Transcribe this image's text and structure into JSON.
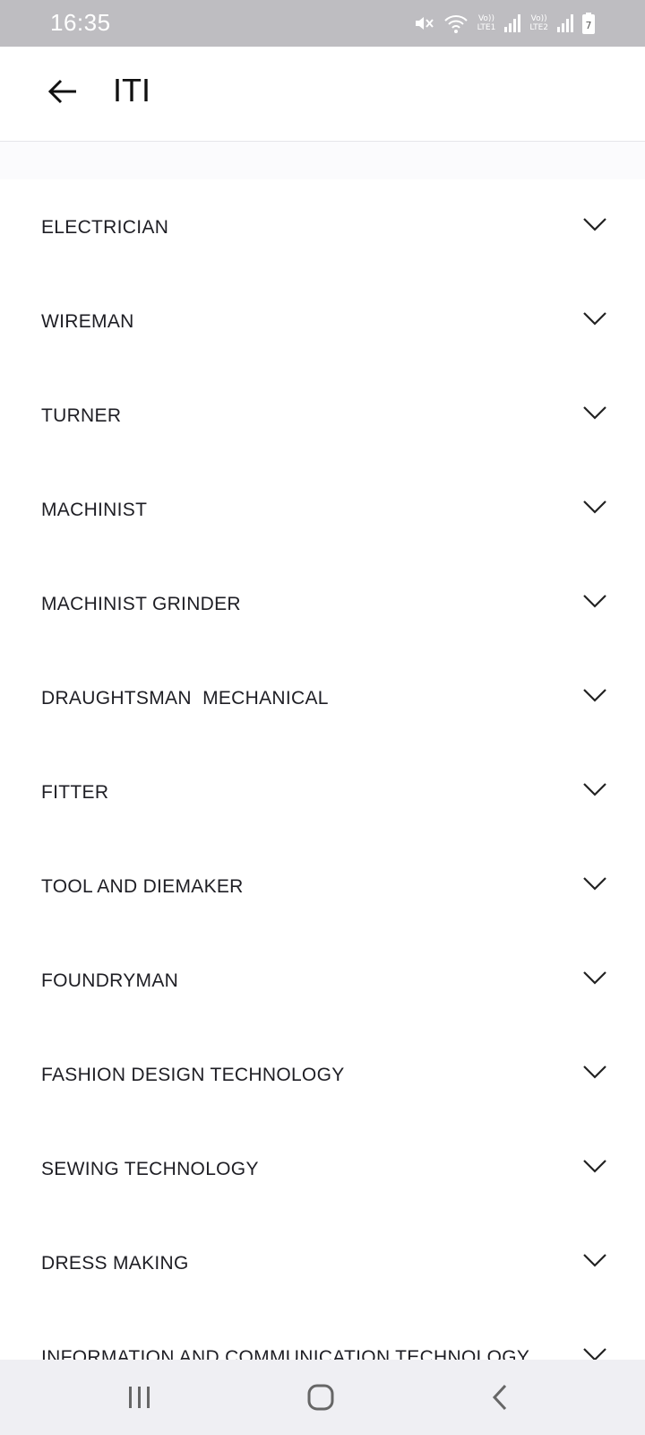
{
  "status_bar": {
    "time": "16:35",
    "icons": [
      "mute-icon",
      "wifi-icon",
      "signal-icon",
      "signal-icon",
      "battery-icon"
    ],
    "sim1_label": "Vo))\nLTE1",
    "sim2_label": "Vo))\nLTE2",
    "battery_level": "7"
  },
  "app_bar": {
    "title": "ITI",
    "back_icon": "back-arrow-icon"
  },
  "trades": [
    {
      "label": "ELECTRICIAN"
    },
    {
      "label": "WIREMAN"
    },
    {
      "label": "TURNER"
    },
    {
      "label": "MACHINIST"
    },
    {
      "label": "MACHINIST GRINDER"
    },
    {
      "label": "DRAUGHTSMAN  MECHANICAL"
    },
    {
      "label": "FITTER"
    },
    {
      "label": "TOOL AND DIEMAKER"
    },
    {
      "label": "FOUNDRYMAN"
    },
    {
      "label": "FASHION DESIGN TECHNOLOGY"
    },
    {
      "label": "SEWING TECHNOLOGY"
    },
    {
      "label": "DRESS MAKING"
    },
    {
      "label": "INFORMATION AND COMMUNICATION TECHNOLOGY"
    }
  ],
  "nav_bar": {
    "buttons": [
      "recent-apps-icon",
      "home-icon",
      "back-icon"
    ]
  },
  "colors": {
    "status_bar_bg": "#bebdc1",
    "page_bg": "#fbfbfd",
    "text": "#1e1e24"
  }
}
